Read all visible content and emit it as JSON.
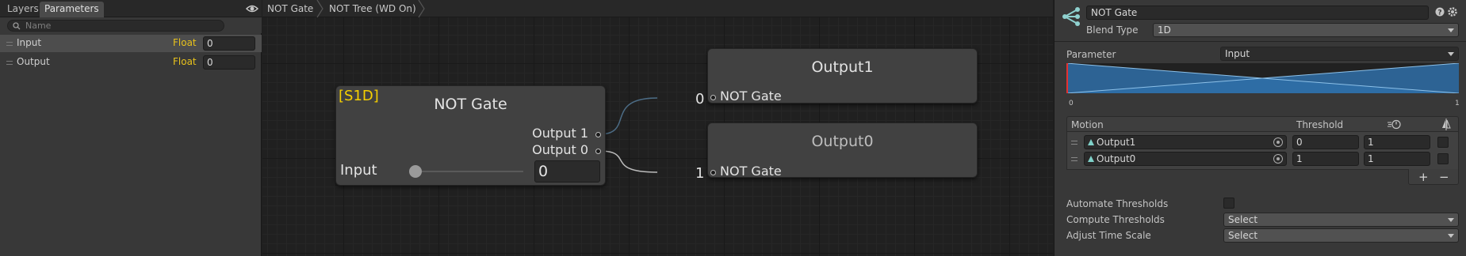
{
  "left_panel": {
    "tabs": [
      "Layers",
      "Parameters"
    ],
    "search": {
      "placeholder": "Name"
    },
    "add_label": "+",
    "params": [
      {
        "name": "Input",
        "type": "Float",
        "value": "0"
      },
      {
        "name": "Output",
        "type": "Float",
        "value": "0"
      }
    ]
  },
  "breadcrumb": [
    "NOT Gate",
    "NOT Tree (WD On)"
  ],
  "graph": {
    "blend_node": {
      "tag": "[S1D]",
      "title": "NOT  Gate",
      "outputs": [
        "Output 1",
        "Output 0"
      ],
      "param_label": "Input",
      "param_value": "0"
    },
    "state_nodes": [
      {
        "title": "Output1",
        "input_label": "NOT  Gate",
        "threshold": "0"
      },
      {
        "title": "Output0",
        "input_label": "NOT  Gate",
        "threshold": "1"
      }
    ]
  },
  "inspector": {
    "name": "NOT  Gate",
    "blend_type_label": "Blend Type",
    "blend_type_value": "1D",
    "parameter_label": "Parameter",
    "parameter_value": "Input",
    "axis_min": "0",
    "axis_max": "1",
    "motion_header": "Motion",
    "threshold_header": "Threshold",
    "motions": [
      {
        "name": "Output1",
        "threshold": "0",
        "speed": "1"
      },
      {
        "name": "Output0",
        "threshold": "1",
        "speed": "1"
      }
    ],
    "add_label": "+",
    "remove_label": "−",
    "automate_label": "Automate Thresholds",
    "compute_label": "Compute Thresholds",
    "compute_value": "Select",
    "adjust_label": "Adjust Time Scale",
    "adjust_value": "Select"
  },
  "colors": {
    "float_type": "#e8c21c",
    "s1d_tag": "#f6d000",
    "blend_fill": "#2f6fa8",
    "blend_line": "#8cc0e8"
  }
}
